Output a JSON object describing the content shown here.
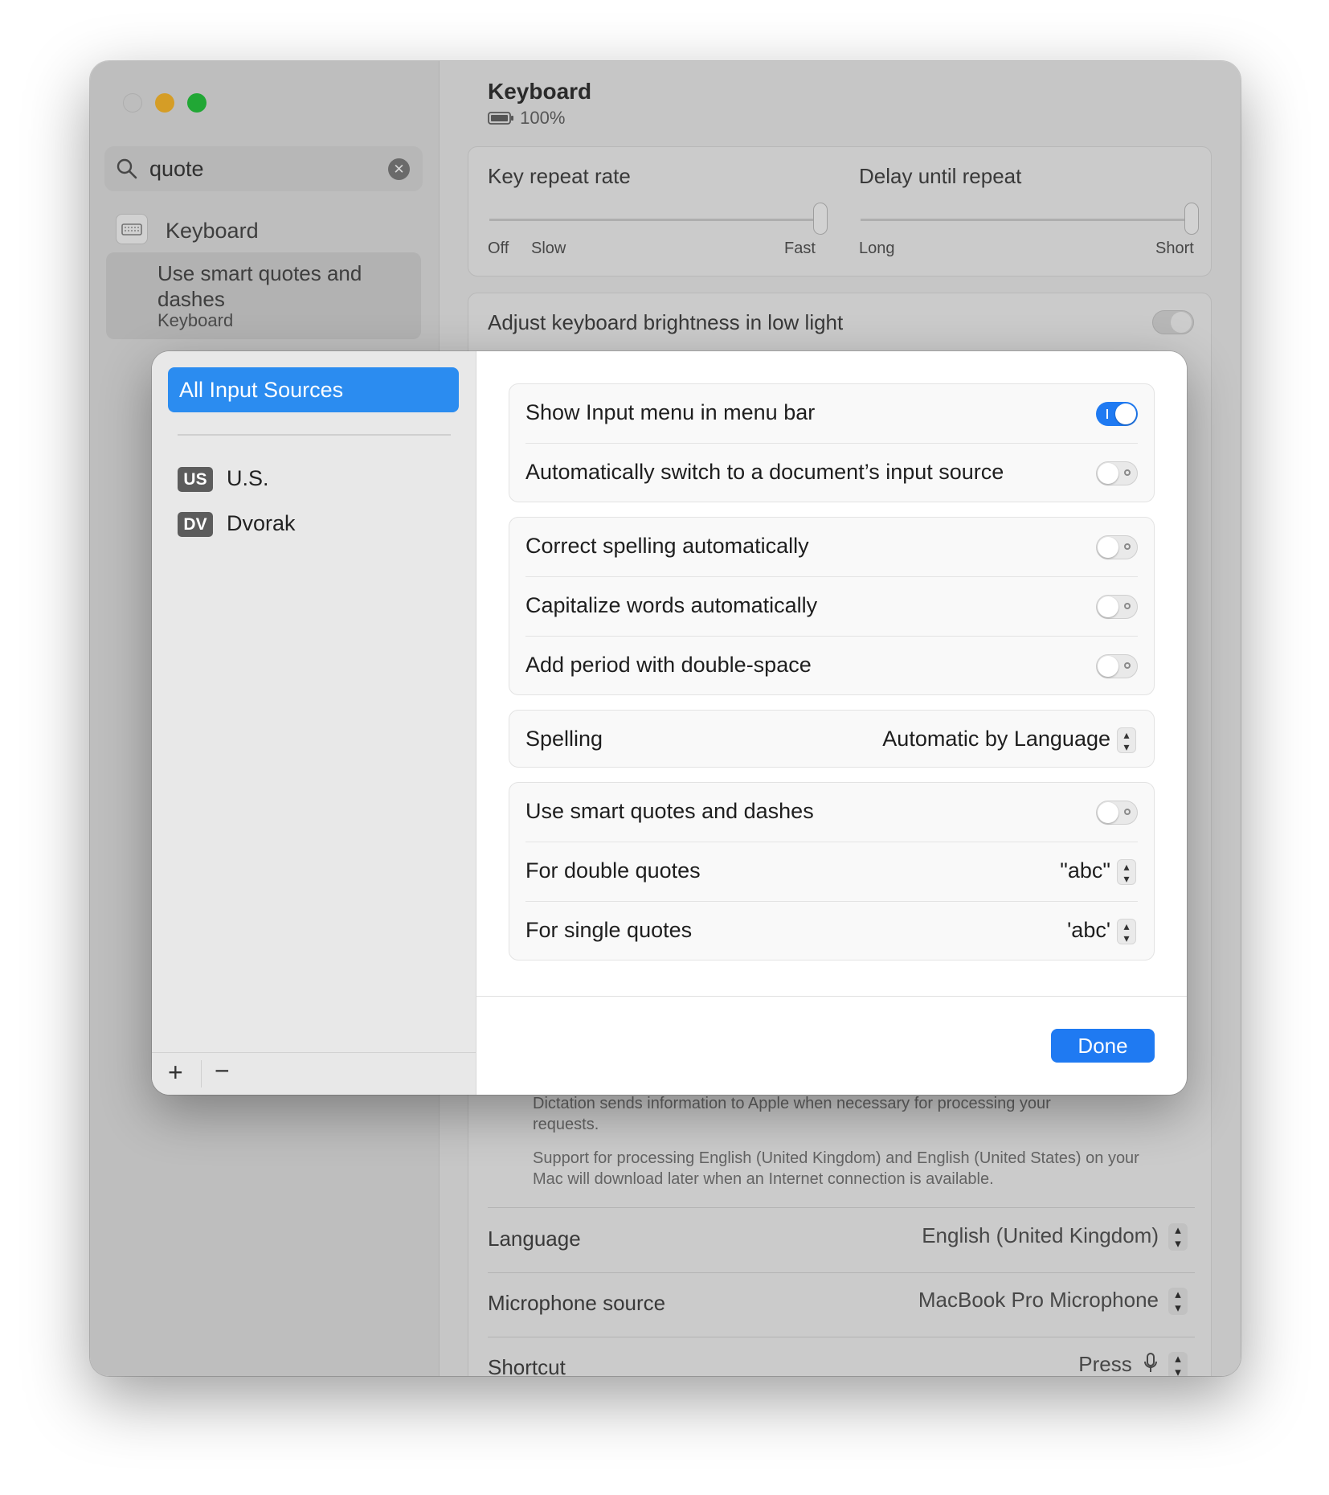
{
  "window": {
    "search": {
      "value": "quote",
      "clear_icon": "xmark-circle-icon"
    },
    "sidebar": {
      "category_label": "Keyboard",
      "result_title": "Use smart quotes and dashes",
      "result_subtitle": "Keyboard"
    },
    "main": {
      "title": "Keyboard",
      "battery": "100%",
      "key_repeat": {
        "label": "Key repeat rate",
        "ticks": [
          "Off",
          "Slow",
          "Fast"
        ],
        "level": 1.0
      },
      "delay_repeat": {
        "label": "Delay until repeat",
        "ticks": [
          "Long",
          "Short"
        ],
        "level": 1.0
      },
      "brightness": {
        "label": "Adjust keyboard brightness in low light",
        "on": false
      },
      "dictation_note1": "Dictation sends information to Apple when necessary for processing your requests.",
      "dictation_note2": "Support for processing English (United Kingdom) and English (United States) on your Mac will download later when an Internet connection is available.",
      "language": {
        "label": "Language",
        "value": "English (United Kingdom)"
      },
      "microphone": {
        "label": "Microphone source",
        "value": "MacBook Pro Microphone"
      },
      "shortcut": {
        "label": "Shortcut",
        "value": "Press"
      }
    }
  },
  "sheet": {
    "sidebar": {
      "selected": "All Input Sources",
      "sources": [
        {
          "badge": "US",
          "name": "U.S."
        },
        {
          "badge": "DV",
          "name": "Dvorak"
        }
      ],
      "add_label": "+",
      "remove_label": "−"
    },
    "group1": [
      {
        "label": "Show Input menu in menu bar",
        "on": true
      },
      {
        "label": "Automatically switch to a document’s input source",
        "on": false
      }
    ],
    "group2": [
      {
        "label": "Correct spelling automatically",
        "on": false
      },
      {
        "label": "Capitalize words automatically",
        "on": false
      },
      {
        "label": "Add period with double-space",
        "on": false
      }
    ],
    "spelling": {
      "label": "Spelling",
      "value": "Automatic by Language"
    },
    "group4": {
      "smart": {
        "label": "Use smart quotes and dashes",
        "on": false
      },
      "double": {
        "label": "For double quotes",
        "value": "\"abc\""
      },
      "single": {
        "label": "For single quotes",
        "value": "'abc'"
      }
    },
    "done_label": "Done"
  },
  "colors": {
    "accent": "#1f7af2",
    "selection": "#2b8cf0"
  }
}
